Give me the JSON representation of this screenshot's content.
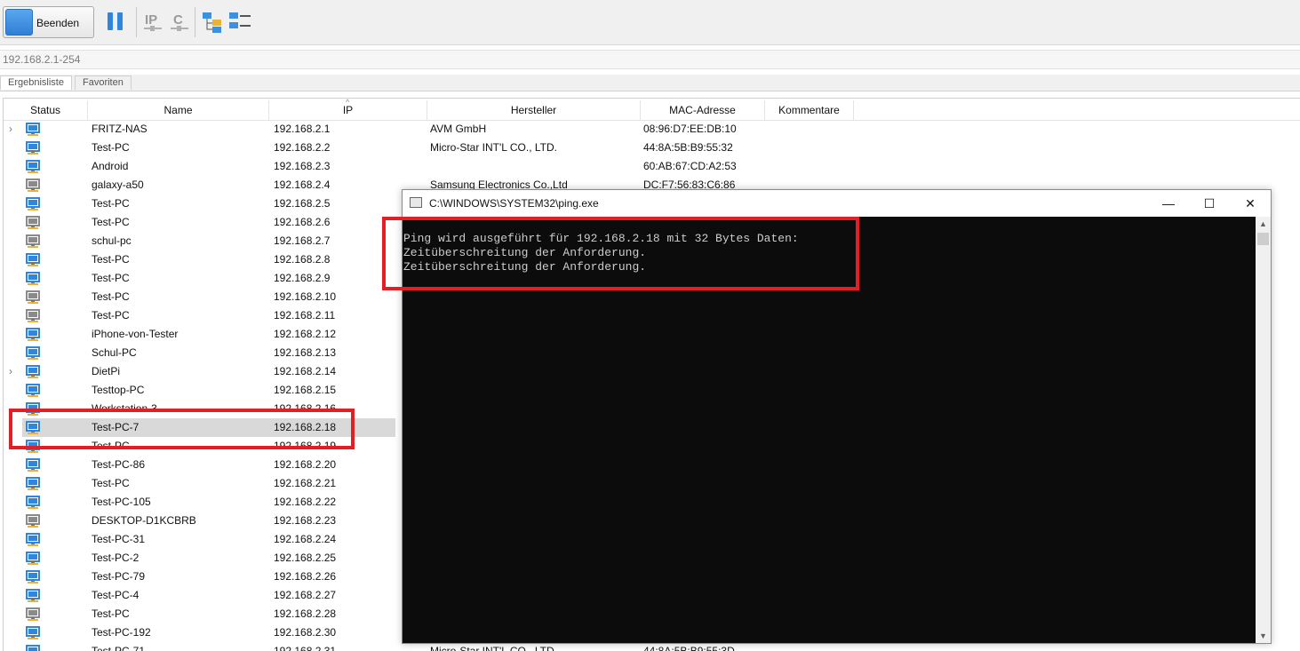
{
  "toolbar": {
    "stop_label": "Beenden",
    "icons": [
      "pause-icon",
      "ip-settings-icon",
      "c-settings-icon",
      "network-tree-icon",
      "list-view-icon"
    ]
  },
  "address": {
    "range": "192.168.2.1-254"
  },
  "tabs": [
    {
      "label": "Ergebnisliste",
      "active": true
    },
    {
      "label": "Favoriten",
      "active": false
    }
  ],
  "columns": [
    "Status",
    "Name",
    "IP",
    "Hersteller",
    "MAC-Adresse",
    "Kommentare"
  ],
  "rows": [
    {
      "name": "FRITZ-NAS",
      "ip": "192.168.2.1",
      "vendor": "AVM GmbH",
      "mac": "08:96:D7:EE:DB:10",
      "expand": true,
      "status": "online"
    },
    {
      "name": "Test-PC",
      "ip": "192.168.2.2",
      "vendor": "Micro-Star INT'L CO., LTD.",
      "mac": "44:8A:5B:B9:55:32",
      "expand": false,
      "status": "online"
    },
    {
      "name": "Android",
      "ip": "192.168.2.3",
      "vendor": "",
      "mac": "60:AB:67:CD:A2:53",
      "expand": false,
      "status": "online"
    },
    {
      "name": "galaxy-a50",
      "ip": "192.168.2.4",
      "vendor": "Samsung Electronics Co.,Ltd",
      "mac": "DC:F7:56:83:C6:86",
      "expand": false,
      "status": "offline"
    },
    {
      "name": "Test-PC",
      "ip": "192.168.2.5",
      "vendor": "",
      "mac": "",
      "expand": false,
      "status": "online"
    },
    {
      "name": "Test-PC",
      "ip": "192.168.2.6",
      "vendor": "",
      "mac": "",
      "expand": false,
      "status": "offline"
    },
    {
      "name": "schul-pc",
      "ip": "192.168.2.7",
      "vendor": "",
      "mac": "",
      "expand": false,
      "status": "offline"
    },
    {
      "name": "Test-PC",
      "ip": "192.168.2.8",
      "vendor": "",
      "mac": "",
      "expand": false,
      "status": "online"
    },
    {
      "name": "Test-PC",
      "ip": "192.168.2.9",
      "vendor": "",
      "mac": "",
      "expand": false,
      "status": "online"
    },
    {
      "name": "Test-PC",
      "ip": "192.168.2.10",
      "vendor": "",
      "mac": "",
      "expand": false,
      "status": "offline"
    },
    {
      "name": "Test-PC",
      "ip": "192.168.2.11",
      "vendor": "",
      "mac": "",
      "expand": false,
      "status": "offline"
    },
    {
      "name": "iPhone-von-Tester",
      "ip": "192.168.2.12",
      "vendor": "",
      "mac": "",
      "expand": false,
      "status": "online"
    },
    {
      "name": "Schul-PC",
      "ip": "192.168.2.13",
      "vendor": "",
      "mac": "",
      "expand": false,
      "status": "online"
    },
    {
      "name": "DietPi",
      "ip": "192.168.2.14",
      "vendor": "",
      "mac": "",
      "expand": true,
      "status": "online"
    },
    {
      "name": "Testtop-PC",
      "ip": "192.168.2.15",
      "vendor": "",
      "mac": "",
      "expand": false,
      "status": "online"
    },
    {
      "name": "Workstation-3",
      "ip": "192.168.2.16",
      "vendor": "",
      "mac": "",
      "expand": false,
      "status": "online"
    },
    {
      "name": "Test-PC-7",
      "ip": "192.168.2.18",
      "vendor": "",
      "mac": "",
      "expand": false,
      "status": "online",
      "selected": true
    },
    {
      "name": "Test-PC",
      "ip": "192.168.2.19",
      "vendor": "",
      "mac": "",
      "expand": false,
      "status": "online"
    },
    {
      "name": "Test-PC-86",
      "ip": "192.168.2.20",
      "vendor": "",
      "mac": "",
      "expand": false,
      "status": "online"
    },
    {
      "name": "Test-PC",
      "ip": "192.168.2.21",
      "vendor": "",
      "mac": "",
      "expand": false,
      "status": "online"
    },
    {
      "name": "Test-PC-105",
      "ip": "192.168.2.22",
      "vendor": "",
      "mac": "",
      "expand": false,
      "status": "online"
    },
    {
      "name": "DESKTOP-D1KCBRB",
      "ip": "192.168.2.23",
      "vendor": "",
      "mac": "",
      "expand": false,
      "status": "offline"
    },
    {
      "name": "Test-PC-31",
      "ip": "192.168.2.24",
      "vendor": "",
      "mac": "",
      "expand": false,
      "status": "online"
    },
    {
      "name": "Test-PC-2",
      "ip": "192.168.2.25",
      "vendor": "",
      "mac": "",
      "expand": false,
      "status": "online"
    },
    {
      "name": "Test-PC-79",
      "ip": "192.168.2.26",
      "vendor": "",
      "mac": "",
      "expand": false,
      "status": "online"
    },
    {
      "name": "Test-PC-4",
      "ip": "192.168.2.27",
      "vendor": "",
      "mac": "",
      "expand": false,
      "status": "online"
    },
    {
      "name": "Test-PC",
      "ip": "192.168.2.28",
      "vendor": "",
      "mac": "",
      "expand": false,
      "status": "offline"
    },
    {
      "name": "Test-PC-192",
      "ip": "192.168.2.30",
      "vendor": "",
      "mac": "",
      "expand": false,
      "status": "online"
    },
    {
      "name": "Test-PC-71",
      "ip": "192.168.2.31",
      "vendor": "Micro-Star INT'L CO., LTD.",
      "mac": "44:8A:5B:B9:55:3D",
      "expand": false,
      "status": "online"
    }
  ],
  "console": {
    "title": "C:\\WINDOWS\\SYSTEM32\\ping.exe",
    "lines": [
      "Ping wird ausgeführt für 192.168.2.18 mit 32 Bytes Daten:",
      "Zeitüberschreitung der Anforderung.",
      "Zeitüberschreitung der Anforderung."
    ],
    "minimize": "—",
    "maximize": "☐",
    "close": "✕"
  },
  "colors": {
    "highlight": "#e31e24",
    "online": "#2f86de",
    "offline": "#8a8a8a",
    "console_bg": "#0c0c0c"
  }
}
